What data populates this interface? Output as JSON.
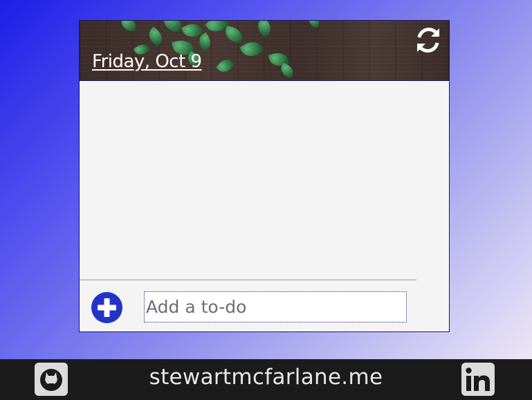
{
  "app": {
    "date_label": "Friday, Oct 9",
    "refresh_icon": "refresh-icon",
    "add_icon": "plus-circle-icon",
    "todo_input": {
      "placeholder": "Add a to-do",
      "value": ""
    },
    "todos": []
  },
  "footer": {
    "site_link": "stewartmcfarlane.me",
    "github_icon": "github-icon",
    "linkedin_icon": "linkedin-icon"
  },
  "colors": {
    "background_start": "#1e1ee8",
    "background_end": "#f7eff6",
    "card_bg": "#f4f4f4",
    "accent": "#2234c8",
    "footer_bg": "#1b1b1b"
  }
}
